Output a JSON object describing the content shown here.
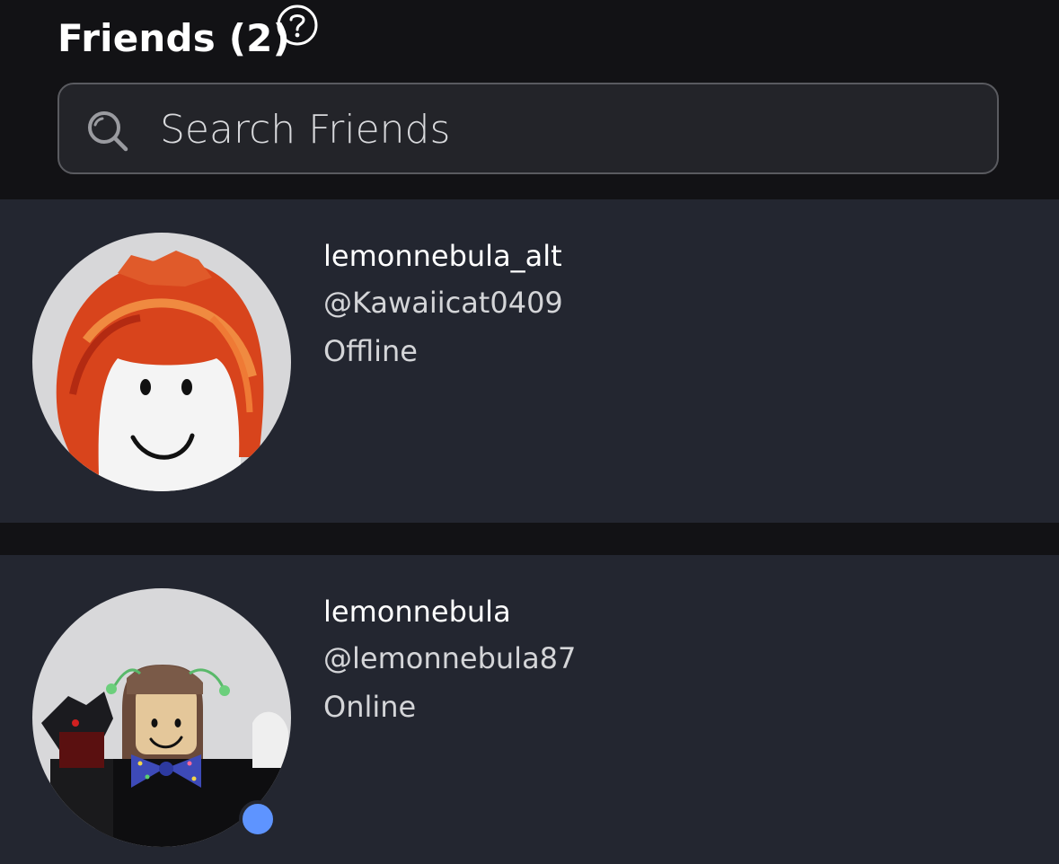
{
  "header": {
    "title": "Friends (2)",
    "help_icon": "question-circle-icon"
  },
  "search": {
    "placeholder": "Search Friends",
    "value": "",
    "icon": "search-icon"
  },
  "friends": [
    {
      "display_name": "lemonnebula_alt",
      "username": "@Kawaiicat0409",
      "status": "Offline"
    },
    {
      "display_name": "lemonnebula",
      "username": "@lemonnebula87",
      "status": "Online",
      "presence_color": "#5e94ff"
    }
  ],
  "colors": {
    "background": "#121215",
    "card": "#232630",
    "online_dot": "#5e94ff"
  }
}
